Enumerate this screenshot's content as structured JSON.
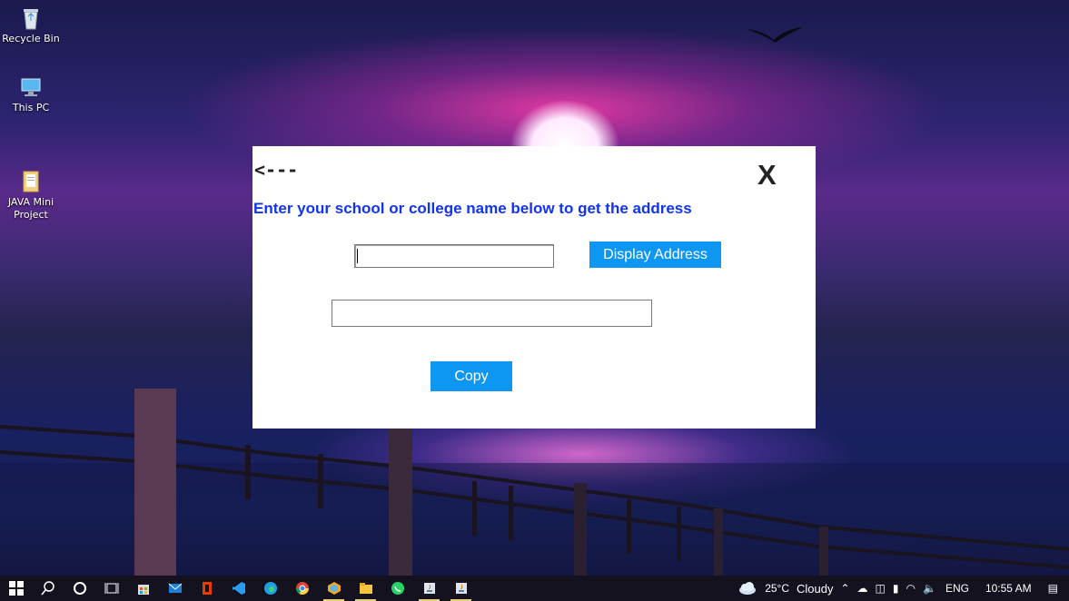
{
  "desktop": {
    "icons": [
      {
        "label": "Recycle Bin",
        "icon": "recycle-bin-icon"
      },
      {
        "label": "This PC",
        "icon": "computer-icon"
      },
      {
        "label": "JAVA Mini\nProject",
        "icon": "folder-icon"
      }
    ]
  },
  "dialog": {
    "back_label": "<---",
    "close_label": "X",
    "prompt": "Enter your school or college name below to get the address",
    "name_input_value": "",
    "address_output_value": "",
    "display_button_label": "Display Address",
    "copy_button_label": "Copy",
    "accent_color": "#0d96f2",
    "prompt_color": "#1034f0"
  },
  "taskbar": {
    "apps": [
      "start",
      "search",
      "cortana",
      "task-view",
      "store",
      "mail",
      "office",
      "vscode",
      "edge",
      "chrome",
      "app-7",
      "file-explorer",
      "whatsapp",
      "java-1",
      "java-2"
    ],
    "tray": {
      "weather_temp": "25°C",
      "weather_text": "Cloudy",
      "language": "ENG",
      "time": "10:55 AM"
    }
  }
}
